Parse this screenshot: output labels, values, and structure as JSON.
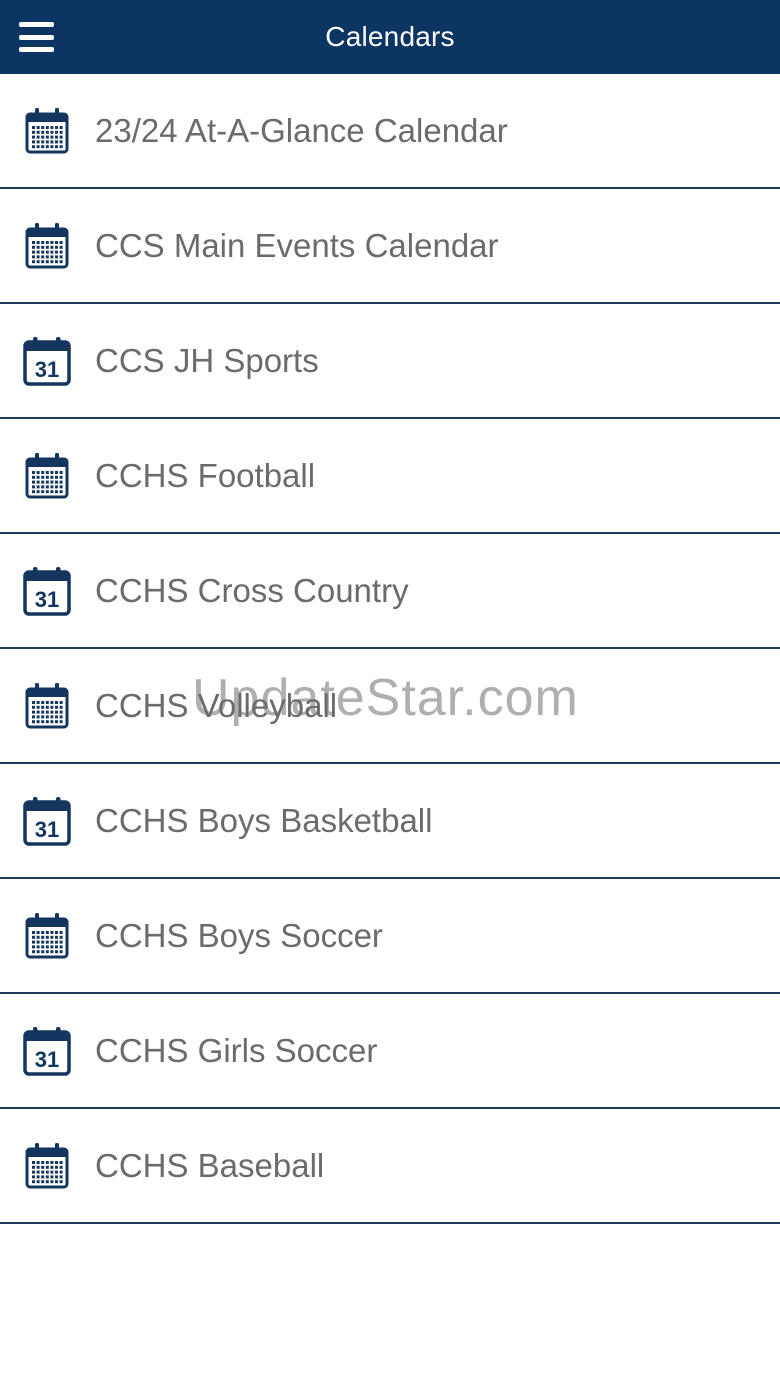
{
  "header": {
    "title": "Calendars",
    "menu_icon": "hamburger-menu-icon",
    "background": "#0d3563"
  },
  "calendars": [
    {
      "label": "23/24 At-A-Glance Calendar",
      "icon": "calendar-grid-icon"
    },
    {
      "label": "CCS Main Events Calendar",
      "icon": "calendar-grid-icon"
    },
    {
      "label": "CCS JH Sports",
      "icon": "calendar-31-icon"
    },
    {
      "label": "CCHS Football",
      "icon": "calendar-grid-icon"
    },
    {
      "label": "CCHS Cross Country",
      "icon": "calendar-31-icon"
    },
    {
      "label": "CCHS Volleyball",
      "icon": "calendar-grid-icon"
    },
    {
      "label": "CCHS Boys Basketball",
      "icon": "calendar-31-icon"
    },
    {
      "label": "CCHS Boys Soccer",
      "icon": "calendar-grid-icon"
    },
    {
      "label": "CCHS Girls Soccer",
      "icon": "calendar-31-icon"
    },
    {
      "label": "CCHS Baseball",
      "icon": "calendar-grid-icon"
    }
  ],
  "watermark": "UpdateStar.com",
  "colors": {
    "accent": "#0d3563",
    "icon": "#14365e",
    "label": "#6b6b6b",
    "divider": "#1b3a5c"
  }
}
